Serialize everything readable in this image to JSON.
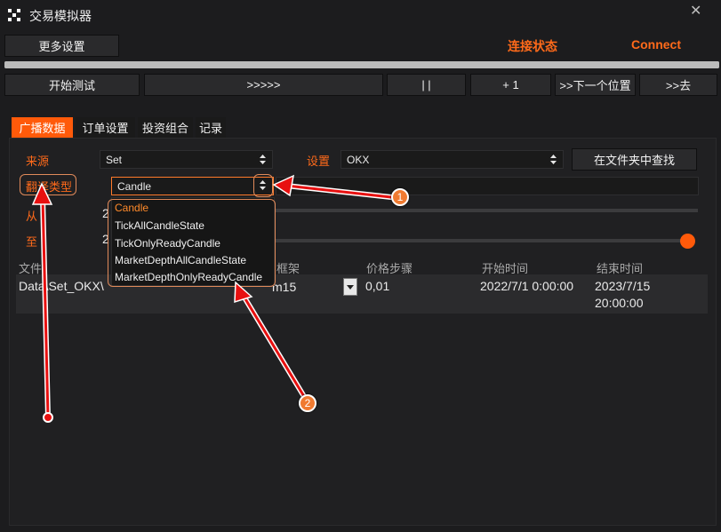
{
  "window": {
    "title": "交易模拟器",
    "close_icon": "close-icon"
  },
  "header": {
    "more_settings": "更多设置",
    "connection_status": "连接状态",
    "connect": "Connect",
    "accent": "#ff6a1a"
  },
  "progress": {
    "value": 1.0
  },
  "toolbar": {
    "start_test": "开始测试",
    "fast_forward": ">>>>>",
    "pause": "| |",
    "plus_one": "+ 1",
    "next_position": ">>下一个位置",
    "go": ">>去"
  },
  "tabs": [
    {
      "label": "广播数据",
      "active": true
    },
    {
      "label": "订单设置",
      "active": false
    },
    {
      "label": "投资组合",
      "active": false
    },
    {
      "label": "记录",
      "active": false
    }
  ],
  "form": {
    "source_label": "来源",
    "source_value": "Set",
    "settings_label": "设置",
    "settings_value": "OKX",
    "find_in_folder": "在文件夹中查找",
    "translation_type_label": "翻译类型",
    "translation_type_value": "Candle",
    "from_label": "从",
    "from_value_partial": "2",
    "to_label": "至",
    "to_value_partial": "2"
  },
  "dropdown": {
    "options": [
      "Candle",
      "TickAllCandleState",
      "TickOnlyReadyCandle",
      "MarketDepthAllCandleState",
      "MarketDepthOnlyReadyCandle"
    ],
    "highlighted": "Candle"
  },
  "table": {
    "headers": {
      "file": "文件",
      "timeframe": "框架",
      "price_step": "价格步骤",
      "start_time": "开始时间",
      "end_time": "结束时间"
    },
    "row": {
      "file": "Data\\Set_OKX\\",
      "timeframe": "m15",
      "price_step": "0,01",
      "start_time": "2022/7/1 0:00:00",
      "end_time_line1": "2023/7/15",
      "end_time_line2": "20:00:00"
    }
  },
  "annotations": {
    "badge1": "1",
    "badge2": "2"
  }
}
